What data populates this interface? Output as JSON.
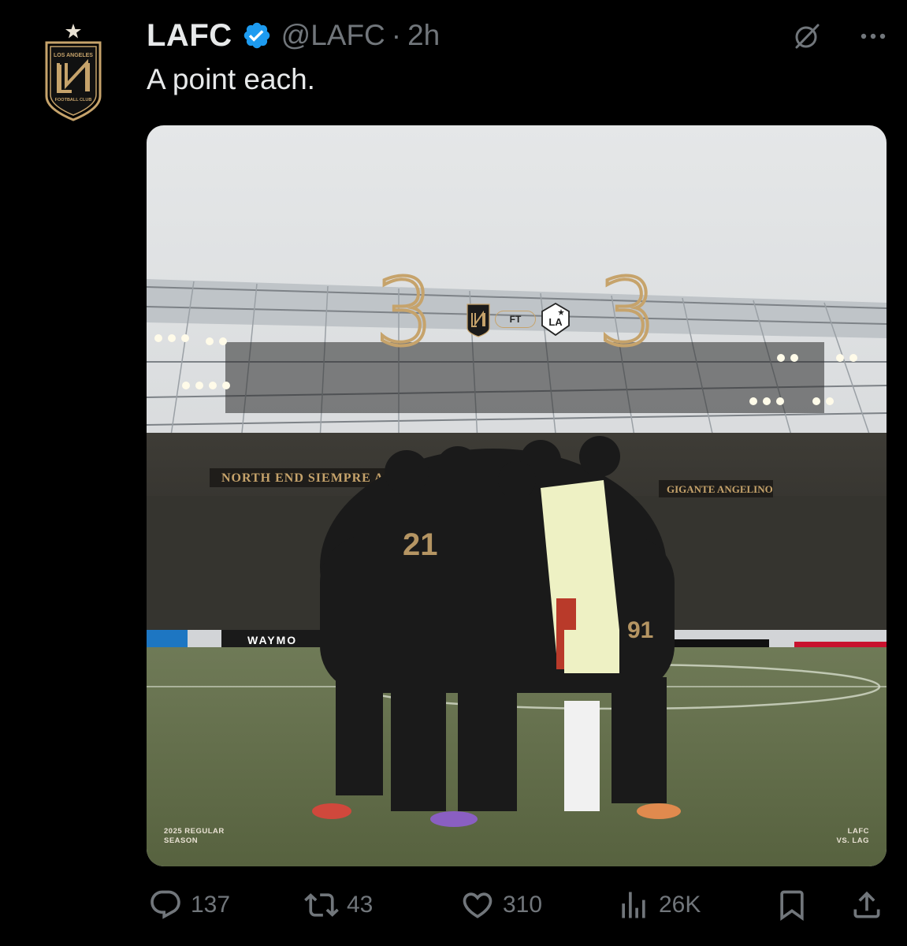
{
  "author": {
    "display_name": "LAFC",
    "handle": "@LAFC",
    "separator": "·",
    "time": "2h",
    "verified": true,
    "avatar_icon": "lafc-crest-icon"
  },
  "tweet": {
    "text": "A point each."
  },
  "media": {
    "score_home": "3",
    "score_away": "3",
    "status": "FT",
    "home_badge": "lafc-crest-icon",
    "away_badge": "la-galaxy-crest-icon",
    "caption_left_line1": "2025 REGULAR",
    "caption_left_line2": "SEASON",
    "caption_right_line1": "LAFC",
    "caption_right_line2": "VS. LAG",
    "accent_color": "#c6a36b"
  },
  "actions": {
    "replies": "137",
    "reposts": "43",
    "likes": "310",
    "views": "26K"
  },
  "colors": {
    "background": "#000000",
    "text_primary": "#e7e9ea",
    "text_secondary": "#71767b",
    "verified_blue": "#1d9bf0",
    "lafc_gold": "#c6a36b"
  }
}
